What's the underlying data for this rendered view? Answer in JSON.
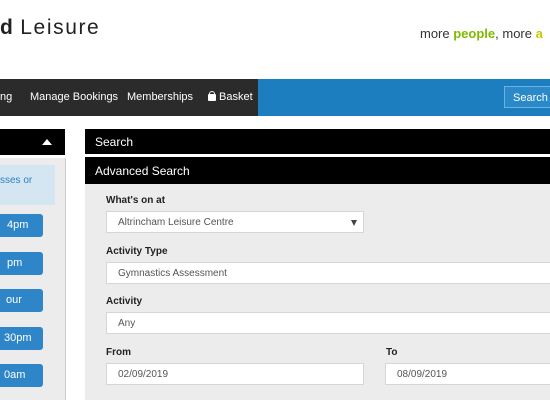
{
  "header": {
    "brand_bold": "d",
    "brand_light": "Leisure",
    "tagline_prefix": "more ",
    "tagline_highlight": "people",
    "tagline_suffix": ", more ",
    "tagline_end": "a"
  },
  "nav": {
    "items": [
      "ng",
      "Manage Bookings",
      "Memberships",
      "Basket"
    ],
    "search_label": "Search"
  },
  "left_panel": {
    "intro_lines": [
      "sses or",
      ""
    ],
    "time_buttons": [
      "4pm",
      "pm",
      "our",
      "30pm",
      "0am"
    ]
  },
  "search": {
    "title": "Search",
    "advanced_title": "Advanced Search",
    "whats_on_label": "What's on at",
    "whats_on_value": "Altrincham Leisure Centre",
    "activity_type_label": "Activity Type",
    "activity_type_value": "Gymnastics Assessment",
    "activity_label": "Activity",
    "activity_value": "Any",
    "from_label": "From",
    "from_value": "02/09/2019",
    "to_label": "To",
    "to_value": "08/09/2019"
  },
  "colors": {
    "nav_blue": "#1c7dbf",
    "nav_dark": "#2b2b2b",
    "button_blue": "#2e86c9",
    "accent_green": "#7fba00"
  }
}
